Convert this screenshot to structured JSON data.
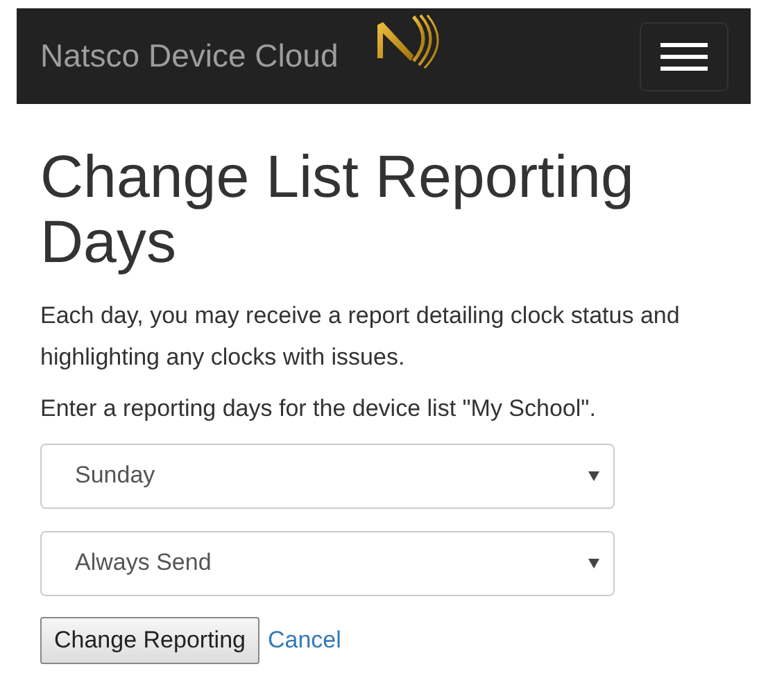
{
  "navbar": {
    "brand": "Natsco Device Cloud"
  },
  "heading": "Change List Reporting Days",
  "intro": "Each day, you may receive a report detailing clock status and highlighting any clocks with issues.",
  "prompt": "Enter a reporting days for the device list \"My School\".",
  "selects": [
    {
      "value": "Sunday"
    },
    {
      "value": "Always Send"
    }
  ],
  "submit_button": "Change Reporting",
  "cancel_link": "Cancel"
}
